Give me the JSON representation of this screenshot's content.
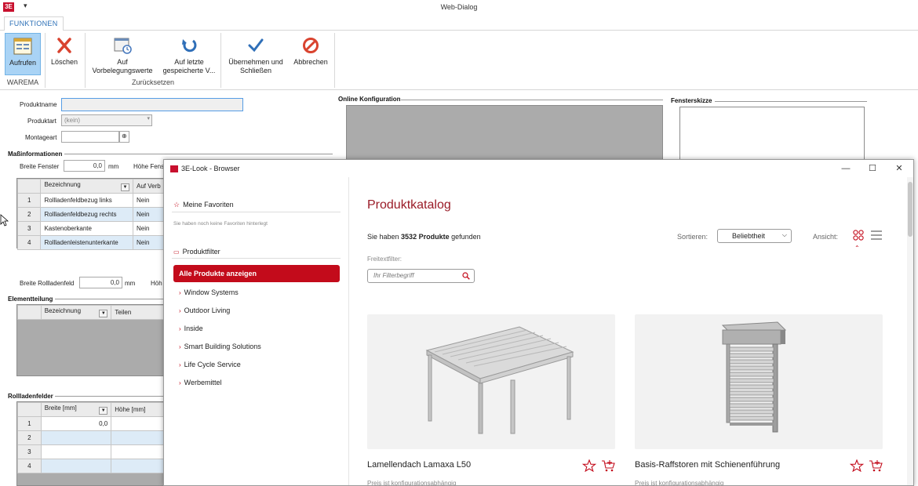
{
  "app": {
    "logo": "3E",
    "qat_icon": "▾",
    "window_title": "Web-Dialog"
  },
  "ribbon": {
    "tab": "FUNKTIONEN",
    "buttons": {
      "aufrufen": "Aufrufen",
      "loeschen": "Löschen",
      "vorbelegung_1": "Auf",
      "vorbelegung_2": "Vorbelegungswerte",
      "letzte_1": "Auf letzte",
      "letzte_2": "gespeicherte V...",
      "uebernehmen_1": "Übernehmen und",
      "uebernehmen_2": "Schließen",
      "abbrechen": "Abbrechen"
    },
    "groups": {
      "warema": "WAREMA",
      "zuruecksetzen": "Zurücksetzen"
    }
  },
  "form": {
    "produktname_label": "Produktname",
    "produktname_value": "",
    "produktart_label": "Produktart",
    "produktart_value": "(kein)",
    "montageart_label": "Montageart",
    "montageart_value": "",
    "online_konfiguration": "Online Konfiguration",
    "fensterskizze": "Fensterskizze",
    "massinformationen": "Maßinformationen",
    "breite_fenster_label": "Breite Fenster",
    "breite_fenster_value": "0,0",
    "unit_mm": "mm",
    "hoehe_fenster_label": "Höhe Fens",
    "mass_grid": {
      "headers": [
        "Bezeichnung",
        "Auf Verb"
      ],
      "rows": [
        {
          "nr": "1",
          "bezeichnung": "Rollladenfeldbezug links",
          "auf": "Nein"
        },
        {
          "nr": "2",
          "bezeichnung": "Rollladenfeldbezug rechts",
          "auf": "Nein"
        },
        {
          "nr": "3",
          "bezeichnung": "Kastenoberkante",
          "auf": "Nein"
        },
        {
          "nr": "4",
          "bezeichnung": "Rollladenleistenunterkante",
          "auf": "Nein"
        }
      ]
    },
    "breite_rollladenfeld_label": "Breite Rollladenfeld",
    "breite_rollladenfeld_value": "0,0",
    "hoehe_label": "Höh",
    "elementteilung": "Elementteilung",
    "element_grid": {
      "headers": [
        "Bezeichnung",
        "Teilen"
      ]
    },
    "rollladenfelder": "Rollladenfelder",
    "felder_grid": {
      "headers": [
        "Breite [mm]",
        "Höhe [mm]"
      ],
      "rows": [
        {
          "nr": "1",
          "breite": "0,0",
          "hoehe": ""
        },
        {
          "nr": "2",
          "breite": "",
          "hoehe": ""
        },
        {
          "nr": "3",
          "breite": "",
          "hoehe": ""
        },
        {
          "nr": "4",
          "breite": "",
          "hoehe": ""
        }
      ]
    }
  },
  "browser": {
    "title": "3E-Look - Browser",
    "controls": {
      "minimize": "—",
      "maximize": "☐",
      "close": "✕"
    },
    "sidebar": {
      "favorites_title": "Meine Favoriten",
      "favorites_empty": "Sie haben noch keine Favoriten hinterlegt",
      "filter_title": "Produktfilter",
      "all_products": "Alle Produkte anzeigen",
      "categories": [
        "Window Systems",
        "Outdoor Living",
        "Inside",
        "Smart Building Solutions",
        "Life Cycle Service",
        "Werbemittel"
      ]
    },
    "main": {
      "title": "Produktkatalog",
      "count_prefix": "Sie haben ",
      "count_value": "3532 Produkte",
      "count_suffix": " gefunden",
      "sort_label": "Sortieren:",
      "sort_value": "Beliebtheit",
      "view_label": "Ansicht:",
      "freetext_label": "Freitextfilter:",
      "freetext_placeholder": "Ihr Filterbegriff",
      "products": [
        {
          "name": "Lamellendach Lamaxa L50",
          "price": "Preis ist konfigurationsabhängig"
        },
        {
          "name": "Basis-Raffstoren mit Schienenführung",
          "price": "Preis ist konfigurationsabhängig"
        }
      ]
    }
  },
  "colors": {
    "accent_red": "#c30b1b",
    "title_red": "#9a1b27",
    "ribbon_blue": "#2b6fb6",
    "active_button": "#a9d3f5"
  }
}
